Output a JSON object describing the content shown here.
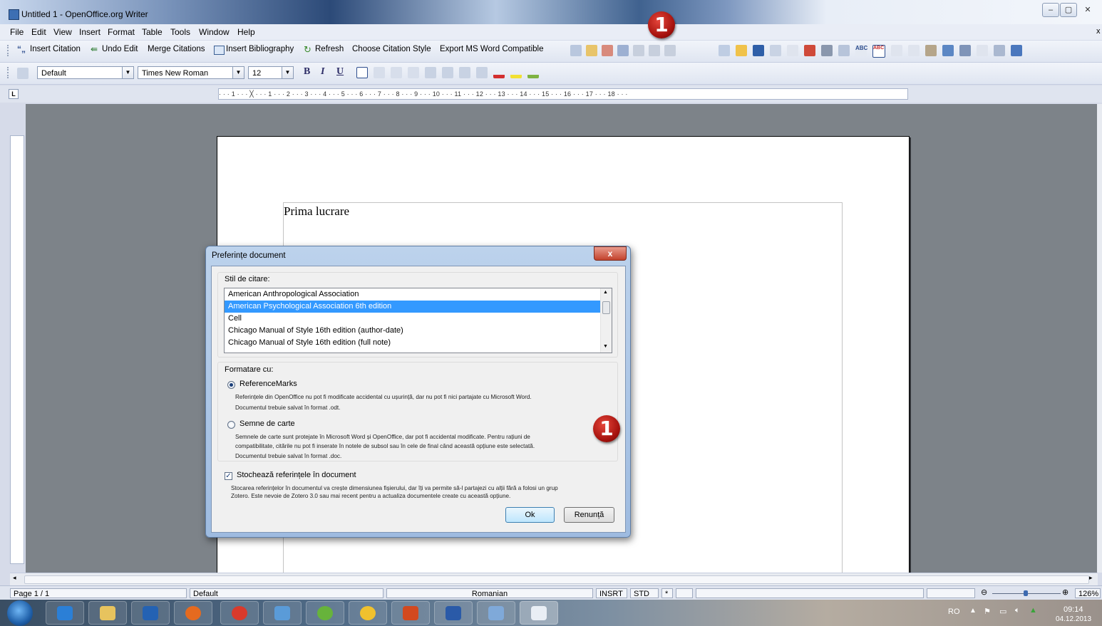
{
  "window": {
    "title": "Untitled 1 - OpenOffice.org Writer",
    "controls": [
      "–",
      "▢",
      "✕"
    ]
  },
  "menu": [
    "File",
    "Edit",
    "View",
    "Insert",
    "Format",
    "Table",
    "Tools",
    "Window",
    "Help"
  ],
  "zotero_toolbar": {
    "insert_citation": "Insert Citation",
    "undo_edit": "Undo Edit",
    "merge_citations": "Merge Citations",
    "insert_bibliography": "Insert Bibliography",
    "refresh": "Refresh",
    "choose_citation_style": "Choose Citation Style",
    "export_ms_word": "Export MS Word Compatible"
  },
  "format_toolbar": {
    "paragraph_style": "Default",
    "font_name": "Times New Roman",
    "font_size": "12",
    "bold": "B",
    "italic": "I",
    "underline": "U"
  },
  "ruler": {
    "numbers": "· · · 1 · · · ╳ · · · 1 · · · 2 · · · 3 · · · 4 · · · 5 · · · 6 · · · 7 · · · 8 · · · 9 · · · 10 · · · 11 · · · 12 · · · 13 · · · 14 · · · 15 · · · 16 · · · 17 · · · 18 · · ·"
  },
  "document": {
    "text": "Prima lucrare"
  },
  "dialog": {
    "title": "Preferințe document",
    "close": "x",
    "style_label": "Stil de citare:",
    "styles": [
      "American Anthropological Association",
      "American Psychological Association 6th edition",
      "Cell",
      "Chicago Manual of Style 16th edition (author-date)",
      "Chicago Manual of Style 16th edition (full note)"
    ],
    "selected_style_index": 1,
    "format_label": "Formatare cu:",
    "option1_label": "ReferenceMarks",
    "option1_desc1": "Referințele din OpenOffice nu pot fi modificate accidental cu ușurință, dar nu pot fi nici partajate cu Microsoft Word.",
    "option1_desc2": "Documentul trebuie salvat în format .odt.",
    "option2_label": "Semne de carte",
    "option2_desc1": "Semnele de carte sunt protejate în Microsoft Word și OpenOffice, dar pot fi accidental modificate. Pentru rațiuni de",
    "option2_desc2": "compatibilitate, citările nu pot fi inserate în notele de subsol sau în cele de final când această opțiune este selectată.",
    "option2_desc3": "Documentul trebuie salvat în format .doc.",
    "store_label": "Stochează referințele în document",
    "store_checked": true,
    "store_desc1": "Stocarea referințelor în documentul va crește dimensiunea fișierului, dar îți va permite să-l partajezi cu alții fără a folosi un grup",
    "store_desc2": "Zotero. Este nevoie de Zotero 3.0 sau mai recent pentru a actualiza documentele create cu această opțiune.",
    "ok": "Ok",
    "cancel": "Renunță"
  },
  "annotations": {
    "badge": "1"
  },
  "statusbar": {
    "page": "Page 1 / 1",
    "style": "Default",
    "language": "Romanian",
    "insert_mode": "INSRT",
    "selection_mode": "STD",
    "modified": "*",
    "zoom": "126%"
  },
  "taskbar": {
    "lang": "RO",
    "time": "09:14",
    "date": "04.12.2013"
  },
  "colors": {
    "selection": "#3399ff",
    "badge": "#c0150f",
    "doc_background": "#7d8389"
  }
}
